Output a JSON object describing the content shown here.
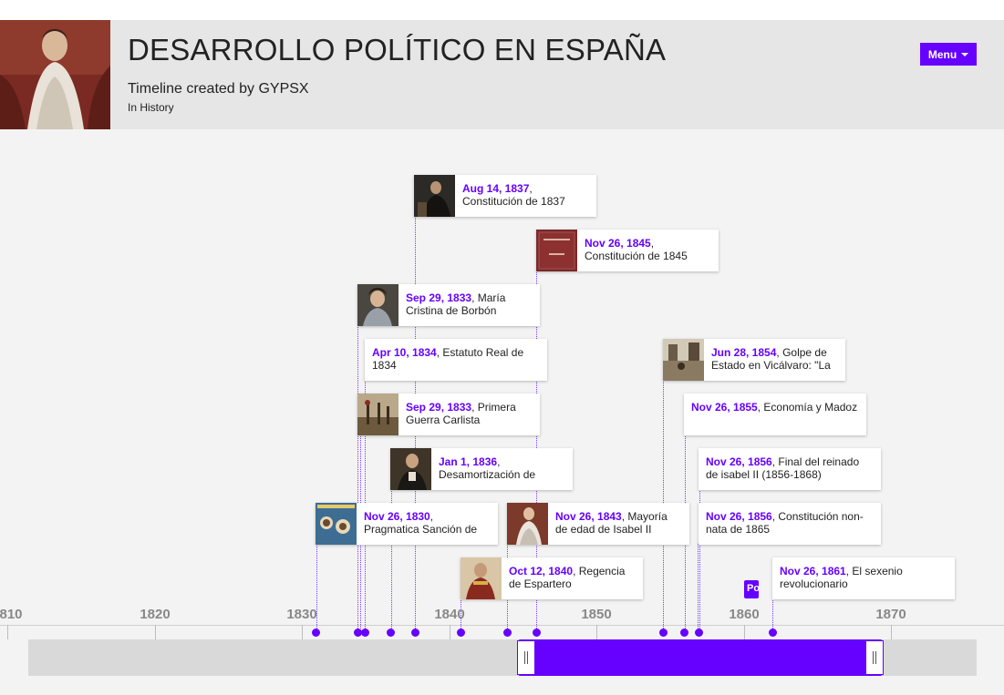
{
  "header": {
    "title": "DESARROLLO POLÍTICO EN ESPAÑA",
    "creator": "Timeline created by GYPSX",
    "category": "In History",
    "menu_label": "Menu"
  },
  "axis": {
    "labels": [
      "810",
      "1820",
      "1830",
      "1840",
      "1850",
      "1860",
      "1870"
    ]
  },
  "flag_label": "Po",
  "events": [
    {
      "date": "Aug 14, 1837",
      "text": "Constitución de 1837"
    },
    {
      "date": "Nov 26, 1845",
      "text": "Constitución de 1845"
    },
    {
      "date": "Sep 29, 1833",
      "text": "María Cristina de Borbón"
    },
    {
      "date": "Apr 10, 1834",
      "text": "Estatuto Real de 1834"
    },
    {
      "date": "Sep 29, 1833",
      "text": "Primera Guerra Carlista"
    },
    {
      "date": "Jan 1, 1836",
      "text": "Desamortización de"
    },
    {
      "date": "Nov 26, 1830",
      "text": "Pragmatica Sanción de"
    },
    {
      "date": "Nov 26, 1843",
      "text": "Mayoría de edad de Isabel II"
    },
    {
      "date": "Oct 12, 1840",
      "text": "Regencia de Espartero"
    },
    {
      "date": "Jun 28, 1854",
      "text": "Golpe de Estado en Vicálvaro: \"La"
    },
    {
      "date": "Nov 26, 1855",
      "text": "Economía y Madoz"
    },
    {
      "date": "Nov 26, 1856",
      "text": "Final del reinado de isabel II (1856-1868)"
    },
    {
      "date": "Nov 26, 1856",
      "text": "Constitución non-nata de 1865"
    },
    {
      "date": "Nov 26, 1861",
      "text": "El sexenio revolucionario"
    }
  ],
  "colors": {
    "accent": "#6600ff",
    "header_bg": "#e6e6e6",
    "page_bg": "#f3f3f3",
    "navbar_bg": "#d9d9d9"
  }
}
